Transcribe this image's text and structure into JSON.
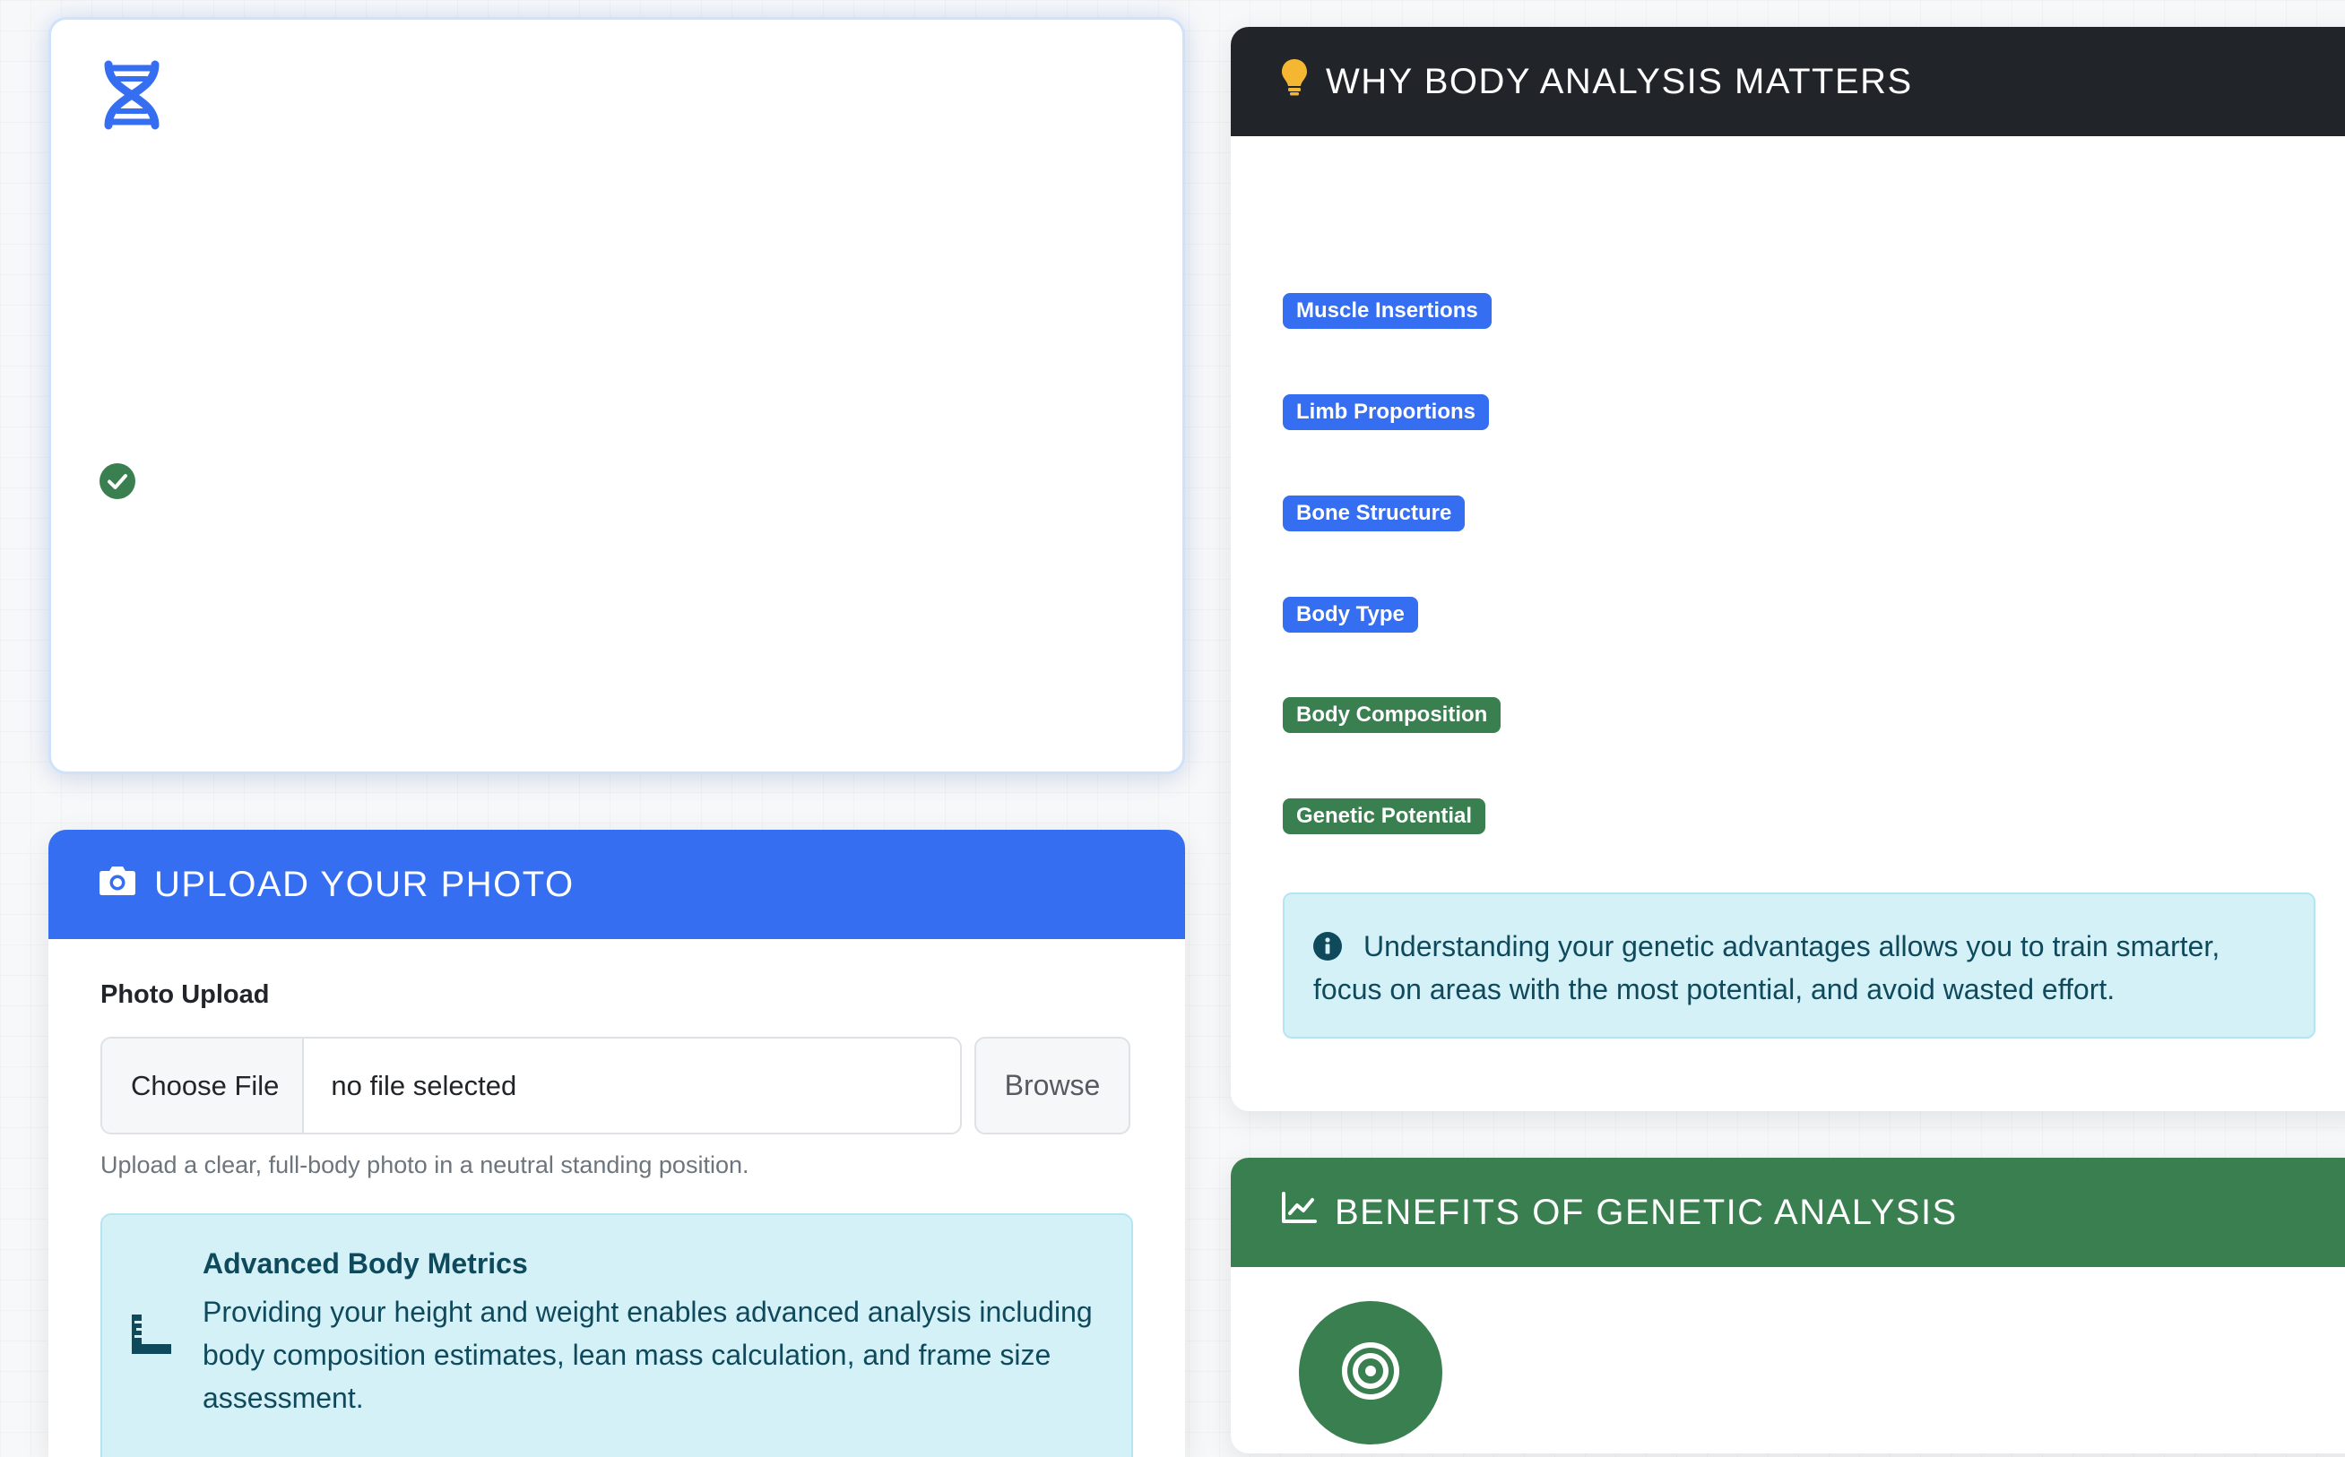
{
  "hero": {
    "icons": [
      "dna-icon",
      "check-circle-icon"
    ]
  },
  "upload": {
    "header": "Upload Your Photo",
    "icon": "camera-icon",
    "label": "Photo Upload",
    "choose_file": "Choose File",
    "file_status": "no file selected",
    "browse": "Browse",
    "help": "Upload a clear, full-body photo in a neutral standing position.",
    "metrics": {
      "icon": "ruler-icon",
      "title": "Advanced Body Metrics",
      "text": "Providing your height and weight enables advanced analysis including body composition estimates, lean mass calculation, and frame size assessment."
    }
  },
  "why": {
    "header": "Why Body Analysis Matters",
    "icon": "lightbulb-icon",
    "badges": [
      {
        "label": "Muscle Insertions",
        "color": "#356ef0"
      },
      {
        "label": "Limb Proportions",
        "color": "#356ef0"
      },
      {
        "label": "Bone Structure",
        "color": "#356ef0"
      },
      {
        "label": "Body Type",
        "color": "#356ef0"
      },
      {
        "label": "Body Composition",
        "color": "#3a7f50"
      },
      {
        "label": "Genetic Potential",
        "color": "#3a7f50"
      }
    ],
    "info": "Understanding your genetic advantages allows you to train smarter, focus on areas with the most potential, and avoid wasted effort."
  },
  "benefits": {
    "header": "Benefits of Genetic Analysis",
    "icon": "chart-line-icon",
    "item_icon": "bullseye-icon"
  },
  "colors": {
    "primary": "#356ef0",
    "success": "#3a7f50",
    "dark": "#212529",
    "info_bg": "#d5f1f8",
    "info_text": "#0f4a5c",
    "warning": "#f5b731"
  }
}
